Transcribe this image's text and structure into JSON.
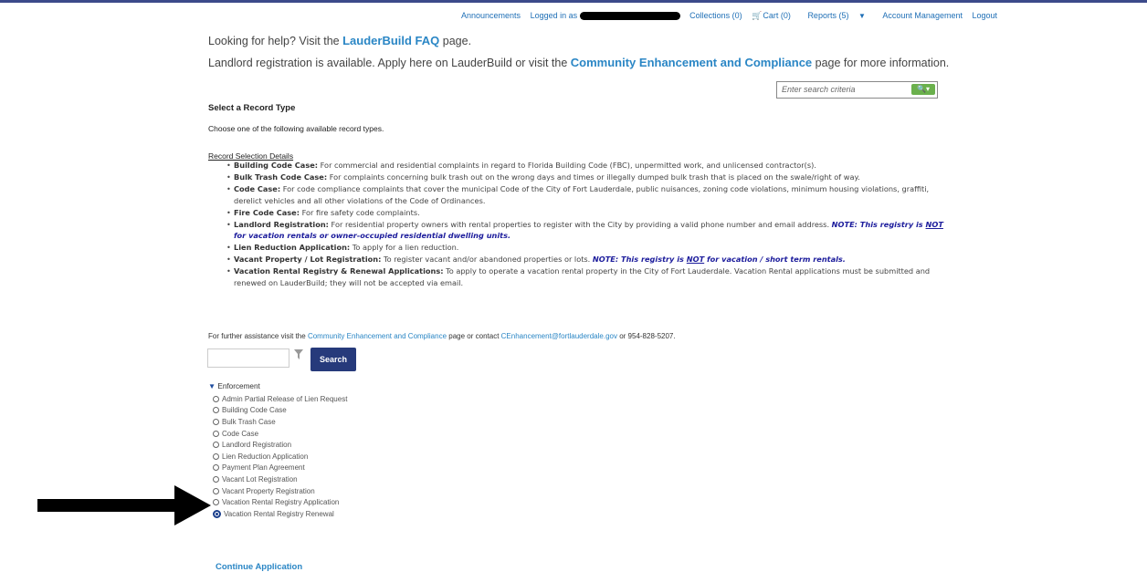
{
  "topnav": {
    "announcements": "Announcements",
    "logged_in": "Logged in as",
    "collections": "Collections (0)",
    "cart": "Cart (0)",
    "reports": "Reports (5)",
    "account": "Account Management",
    "logout": "Logout"
  },
  "help": {
    "line1_pre": "Looking for help? Visit the",
    "line1_link": "LauderBuild FAQ",
    "line1_post": "page.",
    "line2_pre": "Landlord registration is available. Apply here on LauderBuild or visit the",
    "line2_link": "Community Enhancement and Compliance",
    "line2_post": "page for more information."
  },
  "search": {
    "placeholder": "Enter search criteria"
  },
  "select_title": "Select a Record Type",
  "choose_text": "Choose one of the following available record types.",
  "details_heading": "Record Selection Details",
  "details": [
    {
      "term": "Building Code Case:",
      "desc": "For commercial and residential complaints in regard to Florida Building Code (FBC), unpermitted work, and unlicensed contractor(s)."
    },
    {
      "term": "Bulk Trash Code Case:",
      "desc": "For complaints concerning bulk trash out on the wrong days and times or illegally dumped bulk trash that is placed on the swale/right of way."
    },
    {
      "term": "Code Case:",
      "desc": "For code compliance complaints that cover the municipal Code of the City of Fort Lauderdale, public nuisances, zoning code violations, minimum housing violations, graffiti, derelict vehicles and all other violations of the Code of Ordinances."
    },
    {
      "term": "Fire Code Case:",
      "desc": "For fire safety code complaints."
    },
    {
      "term": "Landlord Registration:",
      "desc": "For residential property owners with rental properties to register with the City by providing a valid phone number and email address.",
      "note_pre": "NOTE: This registry is",
      "note_u": "NOT",
      "note_post": "for vacation rentals or owner-occupied residential dwelling units."
    },
    {
      "term": "Lien Reduction Application:",
      "desc": "To apply for a lien reduction."
    },
    {
      "term": "Vacant Property / Lot Registration:",
      "desc": "To register vacant and/or abandoned properties or lots.",
      "note_pre": "NOTE: This registry is",
      "note_u": "NOT",
      "note_post": "for vacation / short term rentals."
    },
    {
      "term": "Vacation Rental Registry & Renewal Applications:",
      "desc": "To apply to operate a vacation rental property in the City of Fort Lauderdale. Vacation Rental applications must be submitted and renewed on LauderBuild; they will not be accepted via email."
    }
  ],
  "assist": {
    "pre": "For further assistance visit the",
    "link": "Community Enhancement and Compliance",
    "mid": "page or contact",
    "email": "CEnhancement@fortlauderdale.gov",
    "post": "or 954-828-5207."
  },
  "search_button": "Search",
  "enforcement": {
    "label": "Enforcement",
    "options": [
      "Admin Partial Release of Lien Request",
      "Building Code Case",
      "Bulk Trash Case",
      "Code Case",
      "Landlord Registration",
      "Lien Reduction Application",
      "Payment Plan Agreement",
      "Vacant Lot Registration",
      "Vacant Property Registration",
      "Vacation Rental Registry Application",
      "Vacation Rental Registry Renewal"
    ],
    "selected": "Vacation Rental Registry Renewal"
  },
  "continue_label": "Continue Application",
  "colors": {
    "link": "#2a86c5",
    "primary_button": "#263a7b",
    "note": "#1c1c9c"
  }
}
